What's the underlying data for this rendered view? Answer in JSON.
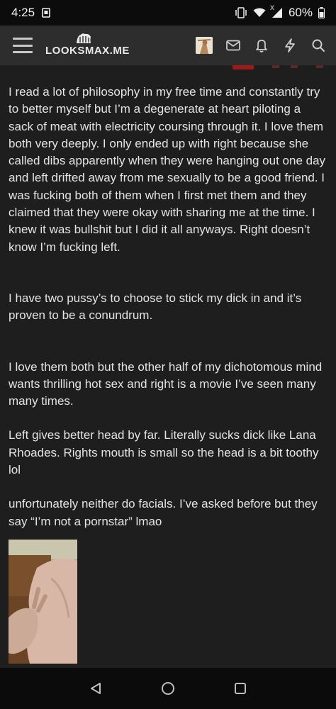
{
  "status_bar": {
    "time": "4:25",
    "battery": "60%",
    "network_label": "X"
  },
  "header": {
    "logo_text": "LOOKSMAX.ME"
  },
  "post": {
    "paragraphs": [
      "I read a lot of philosophy in my free time and constantly try to better myself but I’m a degenerate at heart piloting a sack of meat with electricity coursing through it. I love them both very deeply. I only ended up with right because she called dibs apparently when they were hanging out one day and left drifted away from me sexually to be a good friend. I was fucking both of them when I first met them and they claimed that they were okay with sharing me at the time. I knew it was bullshit but I did it all anyways. Right doesn’t know I’m fucking left.",
      "I have two pussy’s to choose to stick my dick in and it’s proven to be a conundrum.",
      "I love them both but the other half of my dichotomous mind wants thrilling hot sex and right is a movie I’ve seen many many times.",
      "Left gives better head by far. Literally sucks dick like Lana Rhoades. Rights mouth is small so the head is a bit toothy lol",
      "unfortunately neither do facials. I’ve asked before but they say “I’m not a pornstar” lmao"
    ]
  },
  "colors": {
    "header_bg": "#2d2d2d",
    "content_bg": "#1e1e1e",
    "status_bg": "#0c0c0c",
    "badge_red": "#9a1c1c"
  },
  "icons": {
    "menu": "hamburger-icon",
    "mail": "envelope-icon",
    "alerts": "bell-icon",
    "whats_new": "lightning-icon",
    "search": "search-icon"
  }
}
